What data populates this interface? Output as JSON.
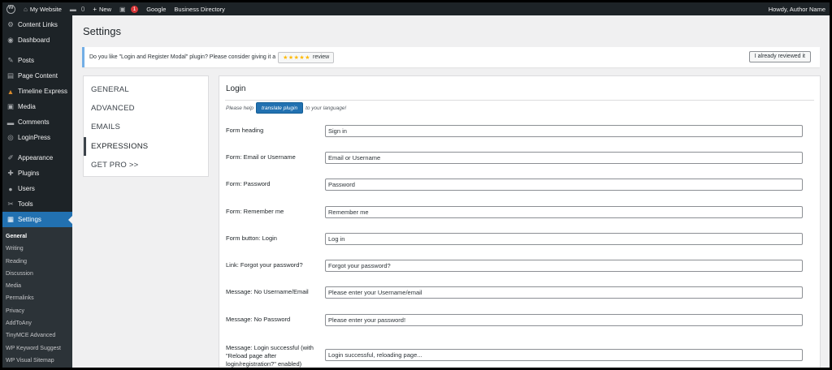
{
  "adminbar": {
    "site_name": "My Website",
    "comments_count": "0",
    "new_label": "New",
    "updates_count": "1",
    "google_label": "Google",
    "directory_label": "Business Directory",
    "howdy": "Howdy, Author Name"
  },
  "sidebar": {
    "items": [
      {
        "label": "Content Links",
        "icon": "gear-icon",
        "glyph": "⚙"
      },
      {
        "label": "Dashboard",
        "icon": "dashboard-icon",
        "glyph": "◉"
      },
      {
        "label": "Posts",
        "icon": "pin-icon",
        "glyph": "✎"
      },
      {
        "label": "Page Content",
        "icon": "page-icon",
        "glyph": "▤"
      },
      {
        "label": "Timeline Express",
        "icon": "timeline-icon",
        "glyph": "▲"
      },
      {
        "label": "Media",
        "icon": "media-icon",
        "glyph": "▣"
      },
      {
        "label": "Comments",
        "icon": "comments-icon",
        "glyph": "▬"
      },
      {
        "label": "LoginPress",
        "icon": "loginpress-icon",
        "glyph": "◎"
      },
      {
        "label": "Appearance",
        "icon": "brush-icon",
        "glyph": "✐"
      },
      {
        "label": "Plugins",
        "icon": "plugin-icon",
        "glyph": "✚"
      },
      {
        "label": "Users",
        "icon": "users-icon",
        "glyph": "●"
      },
      {
        "label": "Tools",
        "icon": "wrench-icon",
        "glyph": "✂"
      },
      {
        "label": "Settings",
        "icon": "settings-icon",
        "glyph": "▦"
      }
    ],
    "submenu": [
      "General",
      "Writing",
      "Reading",
      "Discussion",
      "Media",
      "Permalinks",
      "Privacy",
      "AddToAny",
      "TinyMCE Advanced",
      "WP Keyword Suggest",
      "WP Visual Sitemap"
    ]
  },
  "page": {
    "title": "Settings",
    "notice_text": "Do you like \"Login and Register Modal\" plugin? Please consider giving it a",
    "stars": "★★★★★",
    "review_label": "review",
    "reviewed_label": "I already reviewed it"
  },
  "tabs": [
    "GENERAL",
    "ADVANCED",
    "EMAILS",
    "EXPRESSIONS",
    "GET PRO >>"
  ],
  "panel": {
    "title": "Login",
    "help_prefix": "Please help",
    "translate_label": "translate plugin",
    "help_suffix": "to your language!",
    "fields": [
      {
        "label": "Form heading",
        "value": "Sign in"
      },
      {
        "label": "Form: Email or Username",
        "value": "Email or Username"
      },
      {
        "label": "Form: Password",
        "value": "Password"
      },
      {
        "label": "Form: Remember me",
        "value": "Remember me"
      },
      {
        "label": "Form button: Login",
        "value": "Log in"
      },
      {
        "label": "Link: Forgot your password?",
        "value": "Forgot your password?"
      },
      {
        "label": "Message: No Username/Email",
        "value": "Please enter your Username/email"
      },
      {
        "label": "Message: No Password",
        "value": "Please enter your password!"
      },
      {
        "label": "Message: Login successful (with \"Reload page after login/registration?\" enabled)",
        "value": "Login successful, reloading page..."
      }
    ]
  },
  "colors": {
    "accent": "#2271b1",
    "sidebar_bg": "#1d2327",
    "badge": "#d63638",
    "stars": "#ffb900"
  }
}
